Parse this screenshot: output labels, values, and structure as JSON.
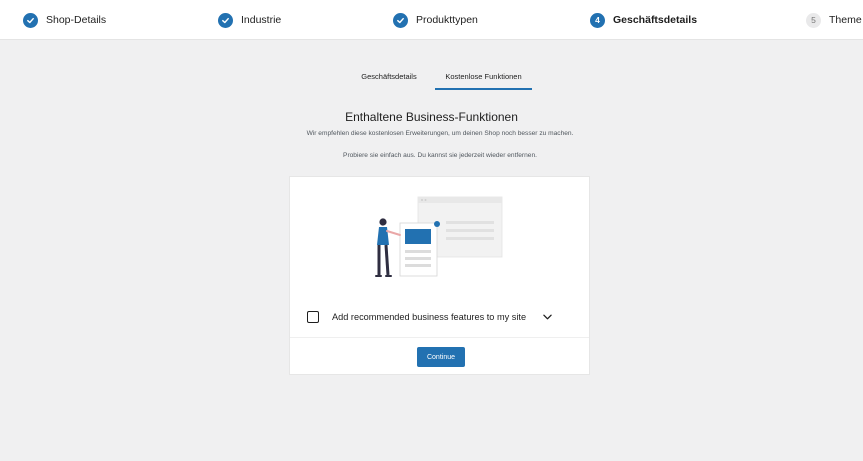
{
  "stepper": {
    "steps": [
      {
        "label": "Shop-Details",
        "status": "done"
      },
      {
        "label": "Industrie",
        "status": "done"
      },
      {
        "label": "Produkttypen",
        "status": "done"
      },
      {
        "label": "Geschäftsdetails",
        "status": "active",
        "number": "4"
      },
      {
        "label": "Theme",
        "status": "pending",
        "number": "5"
      }
    ]
  },
  "tabs": [
    {
      "label": "Geschäftsdetails",
      "selected": false
    },
    {
      "label": "Kostenlose Funktionen",
      "selected": true
    }
  ],
  "main": {
    "headline": "Enthaltene Business-Funktionen",
    "subtext_line1": "Wir empfehlen diese kostenlosen Erweiterungen, um deinen Shop noch besser zu machen.",
    "subtext_line2": "Probiere sie einfach aus. Du kannst sie jederzeit wieder entfernen."
  },
  "card": {
    "option_label": "Add recommended business features to my site",
    "option_checked": false,
    "continue_label": "Continue"
  },
  "icons": {
    "step_done": "check-circle-icon",
    "expand": "chevron-down-icon"
  },
  "colors": {
    "accent": "#2271b1",
    "background": "#f0f0f1",
    "card": "#ffffff"
  }
}
